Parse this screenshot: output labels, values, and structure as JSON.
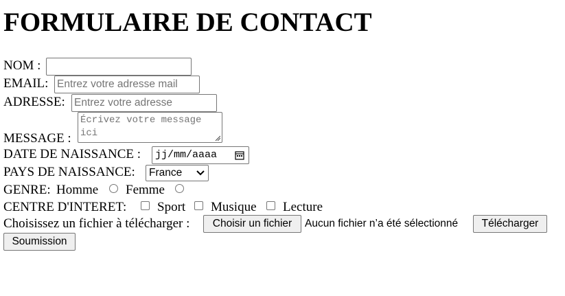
{
  "title": "FORMULAIRE DE CONTACT",
  "form": {
    "nom": {
      "label": "NOM :",
      "value": ""
    },
    "email": {
      "label": "EMAIL:",
      "placeholder": "Entrez votre adresse mail"
    },
    "adresse": {
      "label": "ADRESSE:",
      "placeholder": "Entrez votre adresse"
    },
    "message": {
      "label": "MESSAGE :",
      "placeholder_line1": "Écrivez votre message",
      "placeholder_line2": "ici"
    },
    "date_naissance": {
      "label": "DATE DE NAISSANCE :",
      "value": "jj/mm/aaaa"
    },
    "pays_naissance": {
      "label": "PAYS DE NAISSANCE:",
      "selected": "France"
    },
    "genre": {
      "label": "GENRE:",
      "options": [
        "Homme",
        "Femme"
      ]
    },
    "interets": {
      "label": "CENTRE D'INTERET:",
      "options": [
        "Sport",
        "Musique",
        "Lecture"
      ]
    },
    "fichier": {
      "label": "Choisissez un fichier à télécharger :",
      "choose_button": "Choisir un fichier",
      "status": "Aucun fichier n’a été sélectionné",
      "upload_button": "Télécharger"
    },
    "submit_button": "Soumission"
  },
  "icons": {
    "calendar": "calendar-icon",
    "dropdown": "chevron-down-icon",
    "resize": "resize-grip-icon"
  }
}
